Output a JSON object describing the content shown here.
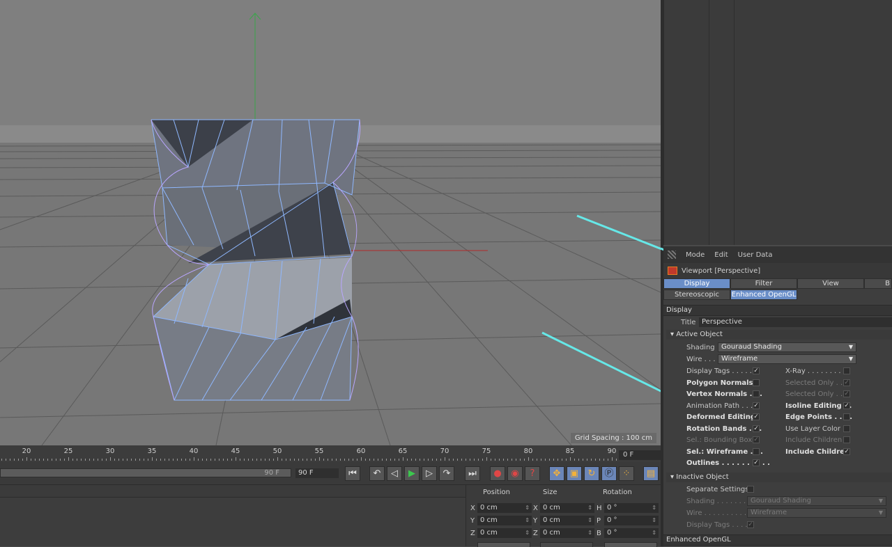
{
  "viewport": {
    "grid_label": "Grid Spacing : 100 cm"
  },
  "attribute_manager": {
    "menu": [
      "Mode",
      "Edit",
      "User Data"
    ],
    "object_title": "Viewport [Perspective]",
    "tabs_row1": [
      "Display",
      "Filter",
      "View",
      "B"
    ],
    "tabs_row2": [
      "Stereoscopic",
      "Enhanced OpenGL"
    ],
    "section_display": "Display",
    "title_label": "Title",
    "title_value": "Perspective",
    "active_object_header": "▾ Active Object",
    "shading_label": "Shading",
    "shading_value": "Gouraud Shading",
    "wire_label": "Wire . . .",
    "wire_value": "Wireframe",
    "left_options": [
      {
        "label": "Display Tags . . . . .",
        "checked": "✓"
      },
      {
        "label": "Polygon Normals",
        "checked": ""
      },
      {
        "label": "Vertex Normals . . .",
        "checked": ""
      },
      {
        "label": "Animation Path . . .",
        "checked": "✓"
      },
      {
        "label": "Deformed Editing",
        "checked": "✓"
      },
      {
        "label": "Rotation Bands . . .",
        "checked": "✓"
      },
      {
        "label": "Sel.: Bounding Box",
        "checked": "✓"
      },
      {
        "label": "Sel.: Wireframe . . .",
        "checked": ""
      },
      {
        "label": "Outlines . . . . . . . . . .",
        "checked": "✓"
      }
    ],
    "right_options": [
      {
        "label": "X-Ray . . . . . . . . . .",
        "checked": ""
      },
      {
        "label": "Selected Only . . .",
        "checked": "✓"
      },
      {
        "label": "Selected Only . . .",
        "checked": "✓"
      },
      {
        "label": "Isoline Editing . .",
        "checked": "✓"
      },
      {
        "label": "Edge Points . . . .",
        "checked": ""
      },
      {
        "label": "Use Layer Color",
        "checked": ""
      },
      {
        "label": "Include Children",
        "checked": ""
      },
      {
        "label": "Include Children",
        "checked": "✓"
      }
    ],
    "inactive_object_header": "▾ Inactive Object",
    "separate_settings_label": "Separate Settings",
    "inactive_shading_label": "Shading . . . . . . . .",
    "inactive_shading_value": "Gouraud Shading",
    "inactive_wire_label": "Wire . . . . . . . . . . .",
    "inactive_wire_value": "Wireframe",
    "inactive_display_tags_label": "Display Tags . . . .",
    "inactive_display_tags_check": "✓",
    "section_enhanced": "Enhanced OpenGL"
  },
  "timeline": {
    "ticks": [
      "20",
      "25",
      "30",
      "35",
      "40",
      "45",
      "50",
      "55",
      "60",
      "65",
      "70",
      "75",
      "80",
      "85",
      "90"
    ],
    "current_frame": "0 F",
    "slider_end": "90 F",
    "end_field": "90 F"
  },
  "coordinates": {
    "headers": [
      "Position",
      "Size",
      "Rotation"
    ],
    "rows": [
      {
        "axis": "X",
        "pos": "0 cm",
        "saxis": "X",
        "size": "0 cm",
        "raxis": "H",
        "rot": "0 °"
      },
      {
        "axis": "Y",
        "pos": "0 cm",
        "saxis": "Y",
        "size": "0 cm",
        "raxis": "P",
        "rot": "0 °"
      },
      {
        "axis": "Z",
        "pos": "0 cm",
        "saxis": "Z",
        "size": "0 cm",
        "raxis": "B",
        "rot": "0 °"
      }
    ]
  },
  "colors": {
    "accent_tab": "#6a8ec8",
    "annotation_arrow": "#66e8e8",
    "wire_line": "#8fb8ff",
    "spline": "#b9a6ff"
  }
}
